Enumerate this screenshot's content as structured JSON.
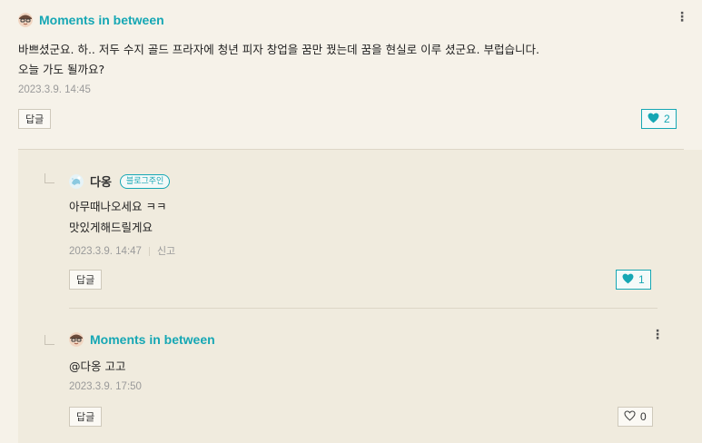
{
  "comment": {
    "author": "Moments in between",
    "text_line1": "바쁘셨군요. 하.. 저두 수지 골드 프라자에 청년 피자 창업을 꿈만 꿨는데 꿈을 현실로 이루 셨군요. 부럽습니다.",
    "text_line2": "오늘 가도 될까요?",
    "timestamp": "2023.3.9. 14:45",
    "reply_label": "답글",
    "likes": "2",
    "menu_icon": "kebab-icon"
  },
  "replies": [
    {
      "author": "다옹",
      "badge": "블로그주인",
      "text_line1": "아무때나오세요 ㅋㅋ",
      "text_line2": "맛있게해드릴게요",
      "timestamp": "2023.3.9. 14:47",
      "report_label": "신고",
      "reply_label": "답글",
      "likes": "1"
    },
    {
      "author": "Moments in between",
      "text_line1": "@다옹 고고",
      "timestamp": "2023.3.9. 17:50",
      "reply_label": "답글",
      "likes": "0"
    }
  ],
  "colors": {
    "accent": "#16a7b4",
    "background": "#f6f2e9",
    "reply_background": "#f0ebde"
  }
}
